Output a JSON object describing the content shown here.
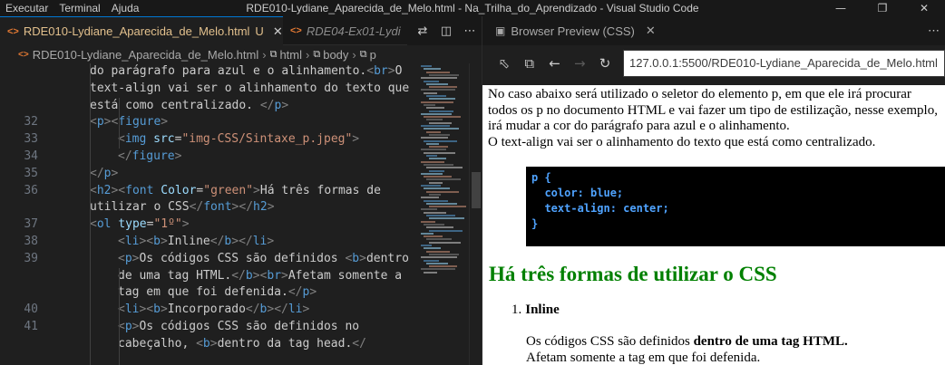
{
  "window": {
    "title": "RDE010-Lydiane_Aparecida_de_Melo.html - Na_Trilha_do_Aprendizado - Visual Studio Code",
    "menu": [
      "Executar",
      "Terminal",
      "Ajuda"
    ]
  },
  "editor": {
    "tabs": [
      {
        "label": "RDE010-Lydiane_Aparecida_de_Melo.html",
        "status": "U",
        "icon": "html-file-icon",
        "active": true
      },
      {
        "label": "RDE04-Ex01-Lydi",
        "icon": "html-file-icon",
        "active": false
      }
    ],
    "breadcrumb": [
      "RDE010-Lydiane_Aparecida_de_Melo.html",
      "html",
      "body",
      "p"
    ],
    "lines": [
      {
        "n": "",
        "html": "do parágrafo para azul e o alinhamento.<span class='tg'>&lt;</span><span class='tn'>br</span><span class='tg'>&gt;</span>O",
        "i": 1
      },
      {
        "n": "",
        "html": "text-align vai ser o alinhamento do texto que",
        "i": 1
      },
      {
        "n": "",
        "html": "está como centralizado. <span class='tg'>&lt;/</span><span class='tn'>p</span><span class='tg'>&gt;</span>",
        "i": 1
      },
      {
        "n": "32",
        "html": "<span class='tg'>&lt;</span><span class='tn'>p</span><span class='tg'>&gt;&lt;</span><span class='tn'>figure</span><span class='tg'>&gt;</span>",
        "i": 1
      },
      {
        "n": "33",
        "html": "<span class='tg'>&lt;</span><span class='tn'>img</span> <span class='an'>src</span>=<span class='av'>\"<span class='u'>img-CSS/Sintaxe_p.jpeg</span>\"</span><span class='tg'>&gt;</span>",
        "i": 2
      },
      {
        "n": "34",
        "html": "<span class='tg'>&lt;/</span><span class='tn'>figure</span><span class='tg'>&gt;</span>",
        "i": 2
      },
      {
        "n": "35",
        "html": "<span class='tg'>&lt;/</span><span class='tn'>p</span><span class='tg'>&gt;</span>",
        "i": 1
      },
      {
        "n": "36",
        "html": "<span class='tg'>&lt;</span><span class='tn'>h2</span><span class='tg'>&gt;&lt;</span><span class='tn'>font</span> <span class='an'>Color</span>=<span class='av'>\"green\"</span><span class='tg'>&gt;</span>Há três formas de",
        "i": 1
      },
      {
        "n": "",
        "html": "utilizar o CSS<span class='tg'>&lt;/</span><span class='tn'>font</span><span class='tg'>&gt;&lt;/</span><span class='tn'>h2</span><span class='tg'>&gt;</span>",
        "i": 1
      },
      {
        "n": "37",
        "html": "<span class='tg'>&lt;</span><span class='tn'>ol</span> <span class='an'>type</span>=<span class='av'>\"1º\"</span><span class='tg'>&gt;</span>",
        "i": 1
      },
      {
        "n": "38",
        "html": "<span class='tg'>&lt;</span><span class='tn'>li</span><span class='tg'>&gt;&lt;</span><span class='tn'>b</span><span class='tg'>&gt;</span>Inline<span class='tg'>&lt;/</span><span class='tn'>b</span><span class='tg'>&gt;&lt;/</span><span class='tn'>li</span><span class='tg'>&gt;</span>",
        "i": 2
      },
      {
        "n": "39",
        "html": "<span class='tg'>&lt;</span><span class='tn'>p</span><span class='tg'>&gt;</span>Os códigos CSS são definidos <span class='tg'>&lt;</span><span class='tn'>b</span><span class='tg'>&gt;</span>dentro",
        "i": 2
      },
      {
        "n": "",
        "html": "de uma tag HTML.<span class='tg'>&lt;/</span><span class='tn'>b</span><span class='tg'>&gt;&lt;</span><span class='tn'>br</span><span class='tg'>&gt;</span>Afetam somente a",
        "i": 2
      },
      {
        "n": "",
        "html": "tag em que foi defenida.<span class='tg'>&lt;/</span><span class='tn'>p</span><span class='tg'>&gt;</span>",
        "i": 2
      },
      {
        "n": "40",
        "html": "<span class='tg'>&lt;</span><span class='tn'>li</span><span class='tg'>&gt;&lt;</span><span class='tn'>b</span><span class='tg'>&gt;</span>Incorporado<span class='tg'>&lt;/</span><span class='tn'>b</span><span class='tg'>&gt;&lt;/</span><span class='tn'>li</span><span class='tg'>&gt;</span>",
        "i": 2
      },
      {
        "n": "41",
        "html": "<span class='tg'>&lt;</span><span class='tn'>p</span><span class='tg'>&gt;</span>Os códigos CSS são definidos no",
        "i": 2
      },
      {
        "n": "",
        "html": "cabeçalho, <span class='tg'>&lt;</span><span class='tn'>b</span><span class='tg'>&gt;</span>dentro da tag head.<span class='tg'>&lt;/</span>",
        "i": 2
      }
    ]
  },
  "preview": {
    "tab_label": "Browser Preview (CSS)",
    "url": "127.0.0.1:5500/RDE010-Lydiane_Aparecida_de_Melo.html",
    "intro": "No caso abaixo será utilizado o seletor do elemento p, em que ele irá procurar todos os p no documento HTML e vai fazer um tipo de estilização, nesse exemplo, irá mudar a cor do parágrafo para azul e o alinhamento.\nO text-align vai ser o alinhamento do texto que está como centralizado.",
    "code_image": {
      "selector": "p {",
      "prop1": "  color: blue;",
      "prop2": "  text-align: center;",
      "close": "}"
    },
    "heading": "Há três formas de utilizar o CSS",
    "list_item_num": "1.",
    "list_item": "Inline",
    "para_start": "Os códigos CSS são definidos ",
    "para_bold": "dentro de uma tag HTML.",
    "para_cut": "Afetam somente a tag em que foi defenida."
  }
}
